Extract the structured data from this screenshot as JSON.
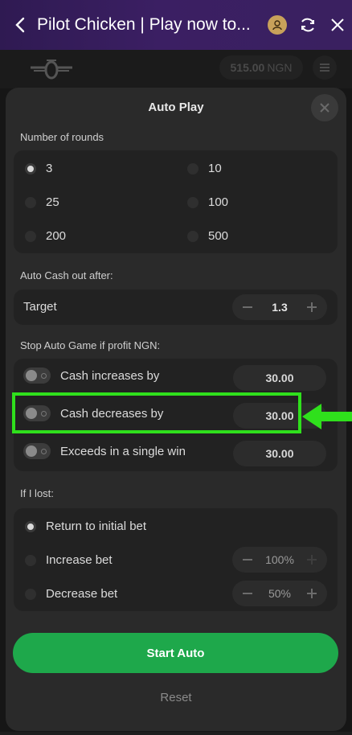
{
  "window": {
    "title": "Pilot Chicken | Play now to..."
  },
  "header": {
    "balance_value": "515.00",
    "balance_currency": "NGN"
  },
  "modal": {
    "title": "Auto Play",
    "rounds": {
      "label": "Number of rounds",
      "options": [
        {
          "label": "3",
          "selected": true
        },
        {
          "label": "10",
          "selected": false
        },
        {
          "label": "25",
          "selected": false
        },
        {
          "label": "100",
          "selected": false
        },
        {
          "label": "200",
          "selected": false
        },
        {
          "label": "500",
          "selected": false
        }
      ]
    },
    "cashout": {
      "label": "Auto Cash out after:",
      "target_label": "Target",
      "target_value": "1.3"
    },
    "stop": {
      "label": "Stop Auto Game if profit NGN:",
      "items": [
        {
          "label": "Cash increases by",
          "value": "30.00",
          "enabled": false
        },
        {
          "label": "Cash decreases by",
          "value": "30.00",
          "enabled": false
        },
        {
          "label": "Exceeds in a single win",
          "value": "30.00",
          "enabled": false
        }
      ]
    },
    "lost": {
      "label": "If I lost:",
      "options": [
        {
          "label": "Return to initial bet",
          "selected": true
        },
        {
          "label": "Increase bet",
          "selected": false,
          "value": "100%"
        },
        {
          "label": "Decrease bet",
          "selected": false,
          "value": "50%"
        }
      ]
    },
    "start_label": "Start Auto",
    "reset_label": "Reset"
  },
  "colors": {
    "accent_green": "#1ea84b",
    "highlight_green": "#2fe01c",
    "title_bar": "#3b1f63"
  }
}
